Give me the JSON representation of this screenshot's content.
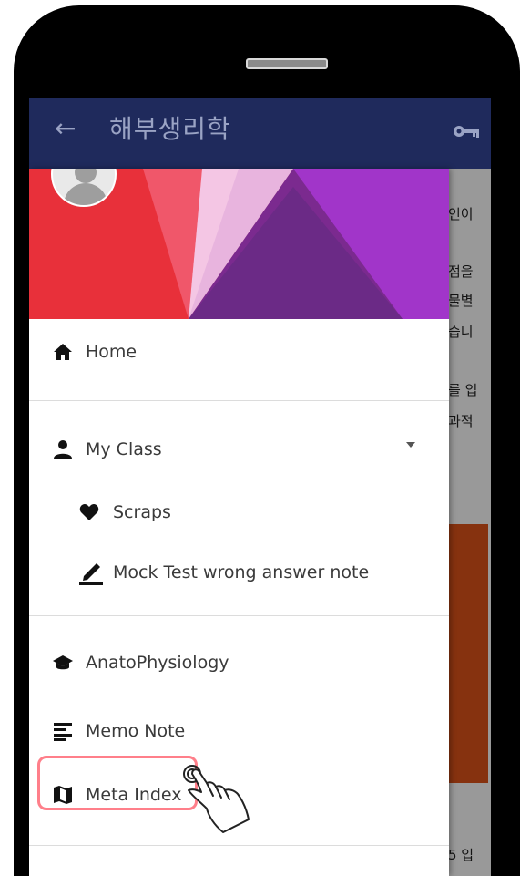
{
  "appbar": {
    "title": "해부생리학",
    "back_icon": "arrow-left-icon",
    "key_icon": "key-icon",
    "color": "#1f2a5c"
  },
  "background_content": {
    "snippets": [
      "인이",
      "점을",
      "물별",
      "습니",
      "를 입",
      "과적",
      "5 입"
    ]
  },
  "drawer": {
    "header_colors": [
      "#e8303a",
      "#f0576a",
      "#f4c6e4",
      "#7b2a8f",
      "#a135c9"
    ],
    "items": [
      {
        "label": "Home",
        "icon": "home-icon"
      },
      {
        "label": "My Class",
        "icon": "person-icon",
        "expanded": true
      },
      {
        "label": "Scraps",
        "icon": "heart-icon"
      },
      {
        "label": "Mock Test wrong answer note",
        "icon": "pencil-icon"
      },
      {
        "label": "AnatoPhysiology",
        "icon": "graduation-cap-icon"
      },
      {
        "label": "Memo Note",
        "icon": "notes-icon"
      },
      {
        "label": "Meta Index",
        "icon": "map-icon",
        "highlighted": true
      }
    ]
  },
  "highlight_color": "#ff7f8a"
}
